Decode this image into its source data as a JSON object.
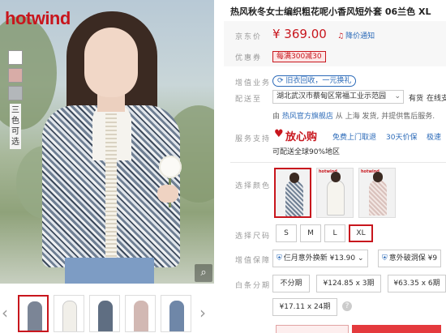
{
  "brand": {
    "logo_text": "hotwind"
  },
  "gallery": {
    "swatch_label": "三色可选",
    "zoom_icon": "magnifier-icon",
    "thumbnails": [
      {
        "color": "#7b8596",
        "active": true
      },
      {
        "color": "#f1efe9",
        "active": false
      },
      {
        "color": "#5f6e82",
        "active": false
      },
      {
        "color": "#d2b8b3",
        "active": false
      },
      {
        "color": "#6f87a8",
        "active": false
      }
    ],
    "prev_icon": "chevron-left-icon",
    "next_icon": "chevron-right-icon"
  },
  "product": {
    "title": "热风秋冬女士编织粗花呢小香风短外套 06兰色 XL",
    "price_label": "京东价",
    "price": "¥ 369.00",
    "price_notice": "降价通知",
    "coupon_label": "优惠券",
    "coupon": "每满300减30",
    "trade_label": "增值业务",
    "trade_in": "旧衣回收，一元换礼",
    "ship_label": "配送至",
    "address": "湖北武汉市蔡甸区常福工业示范园",
    "stock": "有货",
    "stock_extra": "在线支",
    "ship_from_prefix": "由",
    "ship_store": "热风官方旗舰店",
    "ship_from_suffix": "从 上海 发货, 并提供售后服务.",
    "service_label": "服务支持",
    "service_main": "放心购",
    "service_items": [
      "免费上门取退",
      "30天价保",
      "极速"
    ],
    "service_sub": "可配送全球90%地区",
    "color_label": "选择颜色",
    "size_label": "选择尺码",
    "sizes": [
      "S",
      "M",
      "L",
      "XL"
    ],
    "selected_size": "XL",
    "insurance_label": "增值保障",
    "insurance": [
      "仨月意外换新 ¥13.90",
      "意外破洞保 ¥9"
    ],
    "installment_label": "白条分期",
    "installments": [
      "不分期",
      "¥124.85 x 3期",
      "¥63.35 x 6期",
      "¥17.11 x 24期"
    ]
  },
  "colors": {
    "accent": "#c8161d",
    "link": "#2b6ab8"
  }
}
